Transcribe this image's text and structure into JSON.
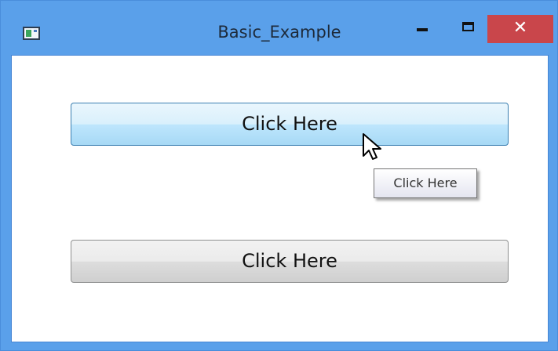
{
  "window": {
    "title": "Basic_Example",
    "app_icon": "window-app-icon",
    "controls": {
      "minimize_icon": "minimize-icon",
      "maximize_icon": "maximize-icon",
      "close_glyph": "✕"
    }
  },
  "content": {
    "buttons": [
      {
        "label": "Click Here",
        "state": "hover"
      },
      {
        "label": "Click Here",
        "state": "normal"
      }
    ],
    "tooltip": "Click Here"
  },
  "colors": {
    "frame": "#5aa0ea",
    "close_button": "#c9464b",
    "hover_button": "#bee6fd",
    "client_background": "#ffffff"
  }
}
